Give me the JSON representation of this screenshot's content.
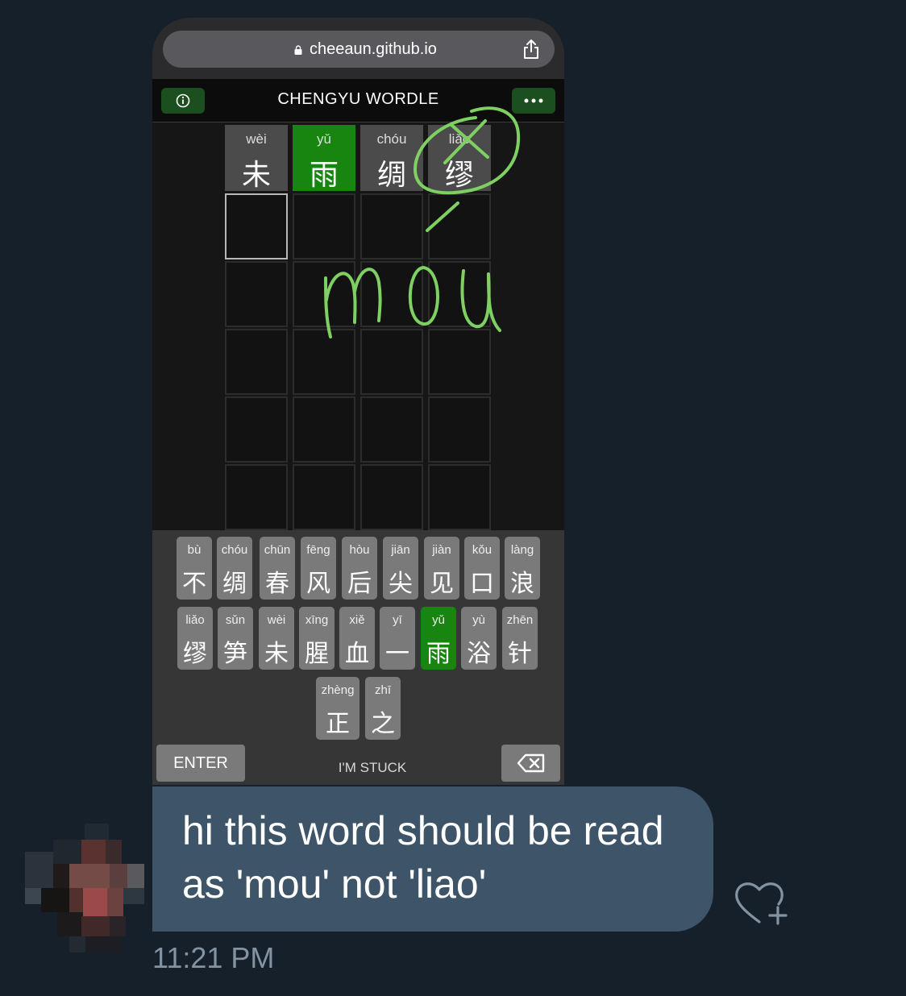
{
  "browser": {
    "url": "cheeaun.github.io"
  },
  "app": {
    "title": "CHENGYU WORDLE"
  },
  "board": {
    "row1": [
      {
        "pinyin": "wèi",
        "char": "未",
        "state": "absent"
      },
      {
        "pinyin": "yǔ",
        "char": "雨",
        "state": "correct"
      },
      {
        "pinyin": "chóu",
        "char": "绸",
        "state": "absent"
      },
      {
        "pinyin": "liǎo",
        "char": "缪",
        "state": "absent"
      }
    ]
  },
  "keyboard": {
    "row1": [
      {
        "pinyin": "bù",
        "char": "不"
      },
      {
        "pinyin": "chóu",
        "char": "绸"
      },
      {
        "pinyin": "chūn",
        "char": "春"
      },
      {
        "pinyin": "fēng",
        "char": "风"
      },
      {
        "pinyin": "hòu",
        "char": "后"
      },
      {
        "pinyin": "jiān",
        "char": "尖"
      },
      {
        "pinyin": "jiàn",
        "char": "见"
      },
      {
        "pinyin": "kǒu",
        "char": "口"
      },
      {
        "pinyin": "làng",
        "char": "浪"
      }
    ],
    "row2": [
      {
        "pinyin": "liǎo",
        "char": "缪"
      },
      {
        "pinyin": "sǔn",
        "char": "笋"
      },
      {
        "pinyin": "wèi",
        "char": "未"
      },
      {
        "pinyin": "xīng",
        "char": "腥"
      },
      {
        "pinyin": "xiě",
        "char": "血"
      },
      {
        "pinyin": "yī",
        "char": "一"
      },
      {
        "pinyin": "yǔ",
        "char": "雨"
      },
      {
        "pinyin": "yù",
        "char": "浴"
      },
      {
        "pinyin": "zhēn",
        "char": "针"
      }
    ],
    "row3": [
      {
        "pinyin": "zhèng",
        "char": "正"
      },
      {
        "pinyin": "zhī",
        "char": "之"
      }
    ],
    "enter_label": "ENTER",
    "stuck_label": "I'M STUCK"
  },
  "annotation": {
    "text": "mou"
  },
  "message": {
    "text": "hi this word should be read as 'mou' not 'liao'",
    "time": "11:21 PM"
  },
  "colors": {
    "correct": "#17850f",
    "annotation": "#7fd062",
    "bubble": "#3e5468",
    "background": "#15202b"
  }
}
